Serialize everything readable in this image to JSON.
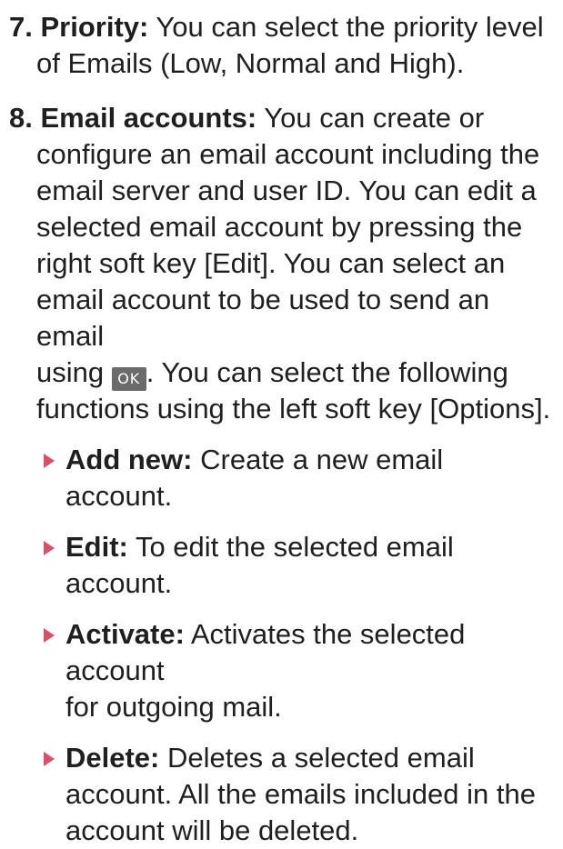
{
  "items": [
    {
      "number": "7.",
      "term": "Priority:",
      "line1": "You can select the priority level",
      "rest": "of Emails (Low, Normal and High)."
    },
    {
      "number": "8.",
      "term": "Email accounts:",
      "line1": "You can create or",
      "lines": [
        "configure an email account including the",
        "email server and user ID. You can edit a",
        "selected email account by pressing the",
        "right soft key [Edit]. You can select an",
        "email account to be used to send an email"
      ],
      "using_before": "using",
      "ok_key_label": "OK",
      "using_after": ". You can select the following",
      "last_line": "functions using the left soft key [Options]."
    }
  ],
  "sub_items": [
    {
      "term": "Add new:",
      "text": "Create a new email account."
    },
    {
      "term": "Edit:",
      "text": "To edit the selected email account."
    },
    {
      "term": "Activate:",
      "text": "Activates the selected account",
      "text2": "for outgoing mail."
    },
    {
      "term": "Delete:",
      "text": "Deletes a selected email",
      "text2": "account. All the emails included in the",
      "text3": "account will be deleted."
    }
  ],
  "colors": {
    "bullet": "#d9506b",
    "ok_key_bg": "#6b6b6b"
  },
  "icons": {
    "ok_key": "ok-key-icon",
    "bullet": "triangle-bullet-icon"
  }
}
